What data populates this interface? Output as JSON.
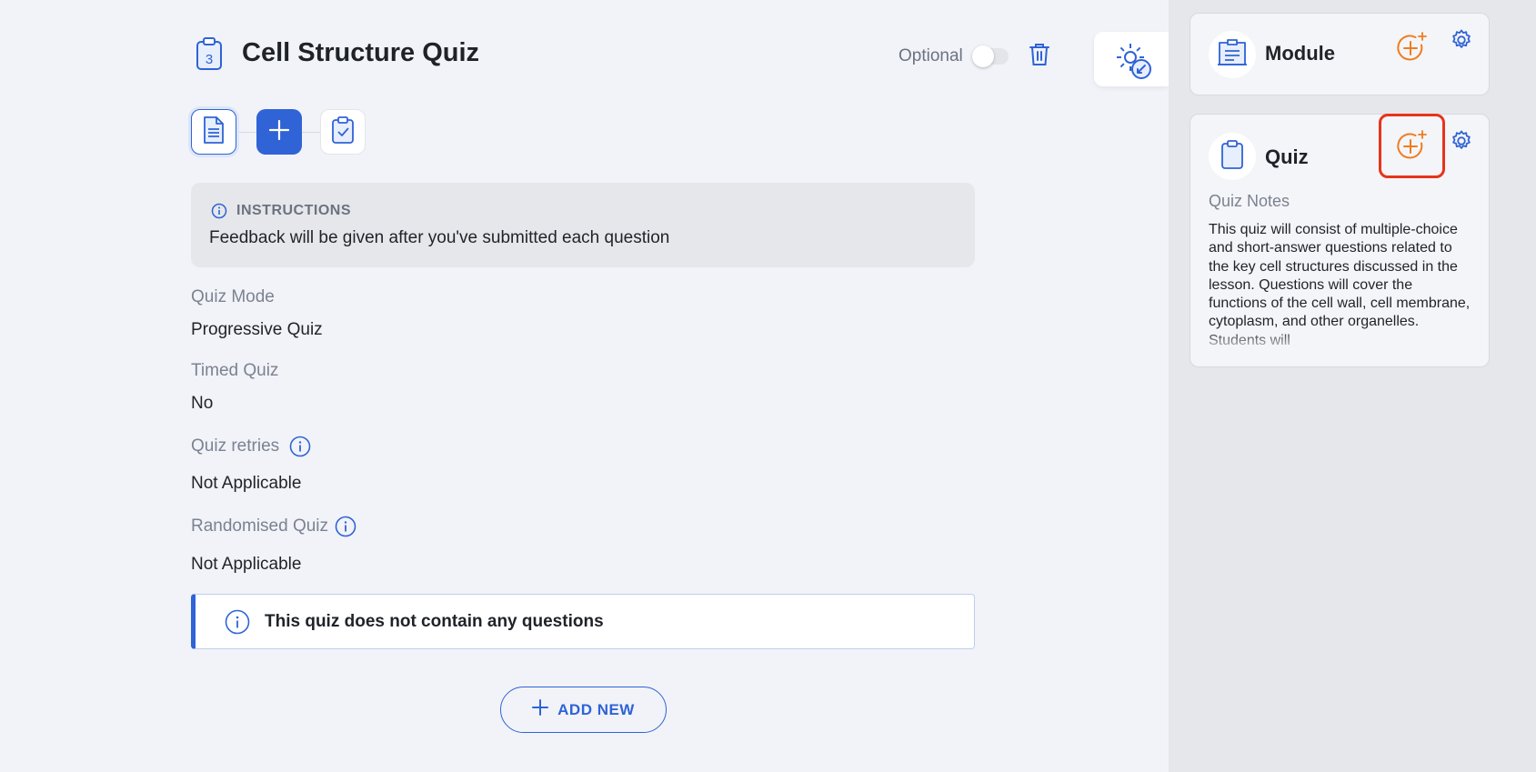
{
  "header": {
    "title": "Cell Structure Quiz",
    "title_icon_number": "3",
    "optional_label": "Optional"
  },
  "instructions": {
    "title": "INSTRUCTIONS",
    "text": "Feedback will be given after you've submitted each question"
  },
  "fields": {
    "mode_label": "Quiz Mode",
    "mode_value": "Progressive Quiz",
    "timed_label": "Timed Quiz",
    "timed_value": "No",
    "retries_label": "Quiz retries",
    "retries_value": "Not Applicable",
    "random_label": "Randomised Quiz",
    "random_value": "Not Applicable"
  },
  "notice": {
    "text": "This quiz does not contain any questions"
  },
  "add_new_label": "ADD NEW",
  "sidebar": {
    "module_title": "Module",
    "quiz_title": "Quiz",
    "notes_label": "Quiz Notes",
    "notes_text": "This quiz will consist of multiple-choice and short-answer questions related to the key cell structures discussed in the lesson. Questions will cover the functions of the cell wall, cell membrane, cytoplasm, and other organelles. Students will"
  },
  "colors": {
    "accent": "#2f63d6",
    "ai_orange": "#f07c1e",
    "highlight_red": "#e8331c"
  },
  "icons": [
    "clipboard-number-icon",
    "trash-icon",
    "gear-collapse-icon",
    "document-icon",
    "plus-icon",
    "clipboard-check-icon",
    "info-icon",
    "module-icon",
    "ai-add-icon",
    "gear-icon",
    "clipboard-icon"
  ]
}
